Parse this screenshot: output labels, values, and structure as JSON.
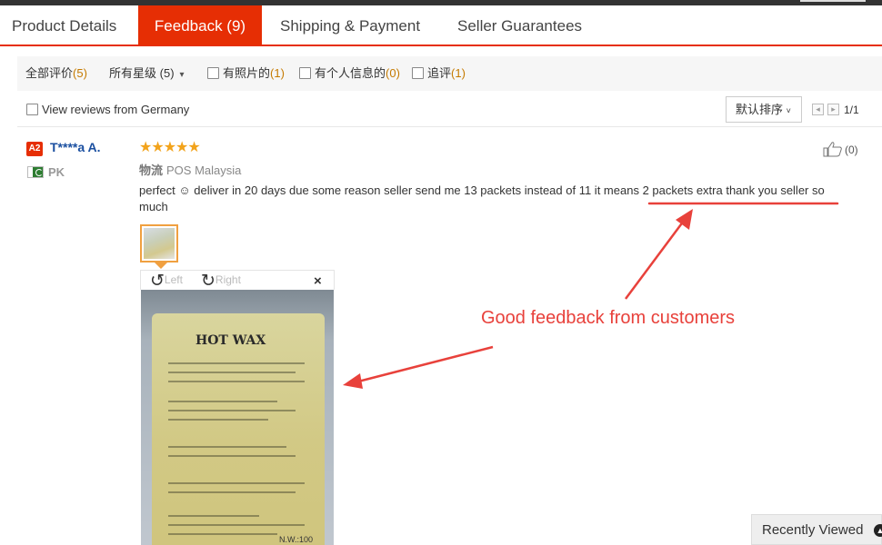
{
  "tabs": [
    {
      "label": "Product Details"
    },
    {
      "label": "Feedback (9)"
    },
    {
      "label": "Shipping & Payment"
    },
    {
      "label": "Seller Guarantees"
    }
  ],
  "filters": {
    "all_label": "全部评价",
    "all_count": "(5)",
    "stars_label": "所有星级",
    "stars_count": "(5)",
    "photos_label": "有照片的",
    "photos_count": "(1)",
    "personal_label": "有个人信息的",
    "personal_count": "(0)",
    "followup_label": "追评",
    "followup_count": "(1)"
  },
  "view_from": "View reviews from Germany",
  "sort_label": "默认排序",
  "pagination": "1/1",
  "review": {
    "badge": "A2",
    "user": "T****a A.",
    "country": "PK",
    "rating": 5,
    "stars": "★★★★★",
    "logistics_label": "物流",
    "logistics_value": "POS Malaysia",
    "likes": "(0)",
    "text_part1": "perfect ☺ deliver in 20 days due some reason seller send me 13 packets instead of 11 it means ",
    "text_highlight": "2 packets extra thank you seller so",
    "text_part2": " much"
  },
  "viewer": {
    "rotate_left": "Left",
    "rotate_right": "Right",
    "close": "×",
    "bag_title": "HOT WAX",
    "bag_note": "N.W.:100"
  },
  "annotation": "Good feedback from customers",
  "recently_viewed": "Recently Viewed",
  "colors": {
    "accent": "#e62e04",
    "star": "#f2a31b",
    "annotation": "#e8413b",
    "link": "#1a4fa0"
  }
}
